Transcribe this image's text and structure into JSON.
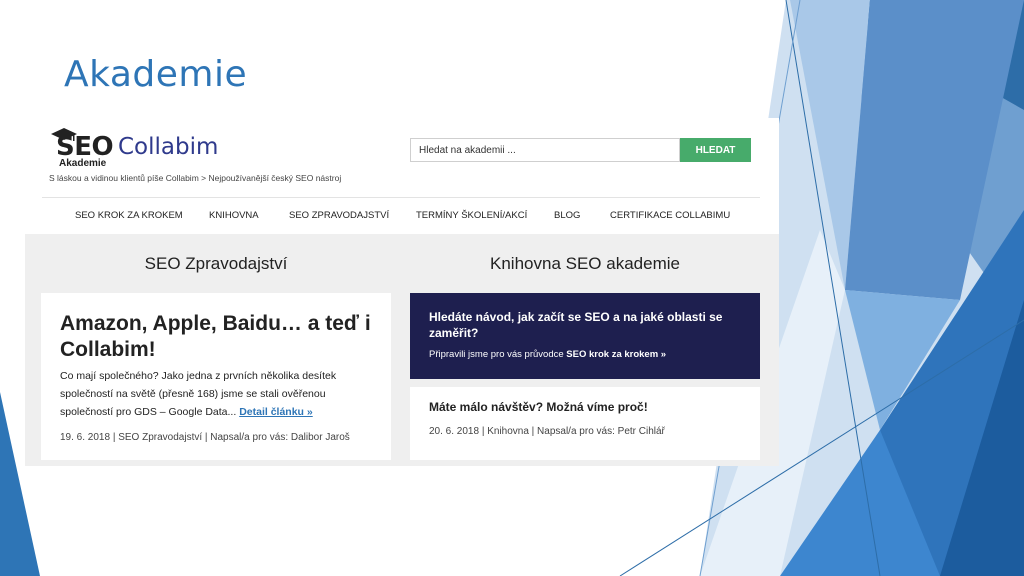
{
  "slide": {
    "title": "Akademie"
  },
  "colors": {
    "title": "#2e75b6",
    "search_button": "#47ab6b",
    "dark_card": "#1e1f4f",
    "link": "#2e75b6"
  },
  "site": {
    "logo": {
      "seo": "SEO",
      "brand": "Collabim",
      "akademie": "Akademie",
      "cap_icon": "graduation-cap-icon"
    },
    "tagline": "S láskou a vidinou klientů píše Collabim > Nejpoužívanější český SEO nástroj",
    "search": {
      "placeholder": "Hledat na akademii ...",
      "button": "HLEDAT"
    },
    "nav": [
      "SEO KROK ZA KROKEM",
      "KNIHOVNA",
      "SEO ZPRAVODAJSTVÍ",
      "TERMÍNY ŠKOLENÍ/AKCÍ",
      "BLOG",
      "CERTIFIKACE COLLABIMU"
    ]
  },
  "left_column": {
    "heading": "SEO Zpravodajství",
    "article": {
      "title": "Amazon, Apple, Baidu… a teď i Collabim!",
      "excerpt": "Co mají společného? Jako jedna z prvních několika desítek společností na světě (přesně 168) jsme se stali ověřenou společností pro GDS – Google Data...",
      "link": "Detail článku »",
      "meta": "19. 6. 2018 | SEO Zpravodajství | Napsal/a pro vás: Dalibor Jaroš"
    }
  },
  "right_column": {
    "heading": "Knihovna SEO akademie",
    "promo": {
      "title": "Hledáte návod, jak začít se SEO a na jaké oblasti se zaměřit?",
      "text": "Připravili jsme pro vás průvodce",
      "link": "SEO krok za krokem »"
    },
    "article": {
      "title": "Máte málo návštěv? Možná víme proč!",
      "meta": "20. 6. 2018 | Knihovna | Napsal/a pro vás: Petr Cihlář"
    }
  }
}
